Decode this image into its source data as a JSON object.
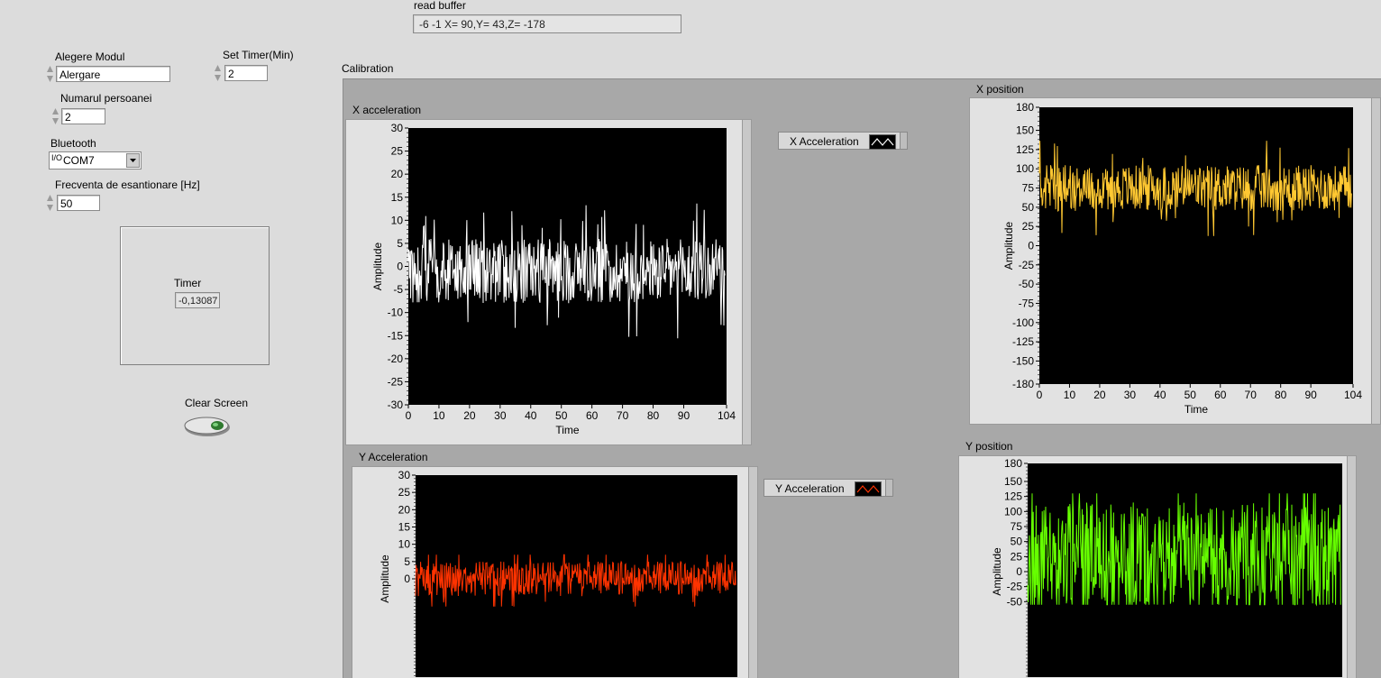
{
  "read_buffer": {
    "label": "read buffer",
    "value": "-6 -1 X= 90,Y= 43,Z= -178"
  },
  "controls": {
    "alegere_modul": {
      "label": "Alegere Modul",
      "value": "Alergare"
    },
    "set_timer": {
      "label": "Set Timer(Min)",
      "value": "2"
    },
    "numarul_persoanei": {
      "label": "Numarul persoanei",
      "value": "2"
    },
    "bluetooth": {
      "label": "Bluetooth",
      "prefix": "I/O",
      "value": "COM7"
    },
    "frecventa": {
      "label": "Frecventa de esantionare [Hz]",
      "value": "50"
    },
    "timer": {
      "label": "Timer",
      "value": "-0,13087"
    },
    "clear_screen": {
      "label": "Clear Screen"
    }
  },
  "calibration": {
    "label": "Calibration"
  },
  "legends": {
    "x_acceleration": "X Acceleration",
    "y_acceleration": "Y Acceleration"
  },
  "colors": {
    "x_acc": "#ffffff",
    "y_acc": "#ff3300",
    "x_pos": "#ffc832",
    "y_pos": "#66ff00"
  },
  "chart_data": [
    {
      "id": "xacc",
      "type": "line",
      "title": "X  acceleration",
      "xlabel": "Time",
      "ylabel": "Amplitude",
      "xlim": [
        0,
        104
      ],
      "ylim": [
        -30,
        30
      ],
      "xticks": [
        "0",
        "10",
        "20",
        "30",
        "40",
        "50",
        "60",
        "70",
        "80",
        "90",
        "104"
      ],
      "yticks": [
        "30",
        "25",
        "20",
        "15",
        "10",
        "5",
        "0",
        "-5",
        "-10",
        "-15",
        "-20",
        "-25",
        "-30"
      ],
      "series": [
        {
          "center": -1,
          "spread": 7,
          "peak_max": 16,
          "peak_min": -19,
          "color": "#ffffff"
        }
      ]
    },
    {
      "id": "xpos",
      "type": "line",
      "title": "X  position",
      "xlabel": "Time",
      "ylabel": "Amplitude",
      "xlim": [
        0,
        104
      ],
      "ylim": [
        -180,
        180
      ],
      "xticks": [
        "0",
        "10",
        "20",
        "30",
        "40",
        "50",
        "60",
        "70",
        "80",
        "90",
        "104"
      ],
      "yticks": [
        "180",
        "150",
        "125",
        "100",
        "75",
        "50",
        "25",
        "0",
        "-25",
        "-50",
        "-75",
        "-100",
        "-125",
        "-150",
        "-180"
      ],
      "series": [
        {
          "center": 75,
          "spread": 30,
          "peak_max": 155,
          "peak_min": -80,
          "color": "#ffc832"
        }
      ]
    },
    {
      "id": "yacc",
      "type": "line",
      "title": "Y Acceleration",
      "xlabel": "Time",
      "ylabel": "Amplitude",
      "xlim": [
        0,
        104
      ],
      "ylim": [
        -30,
        30
      ],
      "xticks": [],
      "yticks": [
        "30",
        "25",
        "20",
        "15",
        "10",
        "5",
        "0"
      ],
      "series": [
        {
          "center": 0,
          "spread": 5,
          "peak_max": 7,
          "peak_min": -8,
          "color": "#ff3300"
        }
      ]
    },
    {
      "id": "ypos",
      "type": "line",
      "title": "Y position",
      "xlabel": "Time",
      "ylabel": "Amplitude",
      "xlim": [
        0,
        104
      ],
      "ylim": [
        -180,
        180
      ],
      "xticks": [],
      "yticks": [
        "180",
        "150",
        "125",
        "100",
        "75",
        "50",
        "25",
        "0",
        "-25",
        "-50"
      ],
      "series": [
        {
          "center": 25,
          "spread": 90,
          "peak_max": 130,
          "peak_min": -55,
          "color": "#66ff00"
        }
      ]
    }
  ]
}
